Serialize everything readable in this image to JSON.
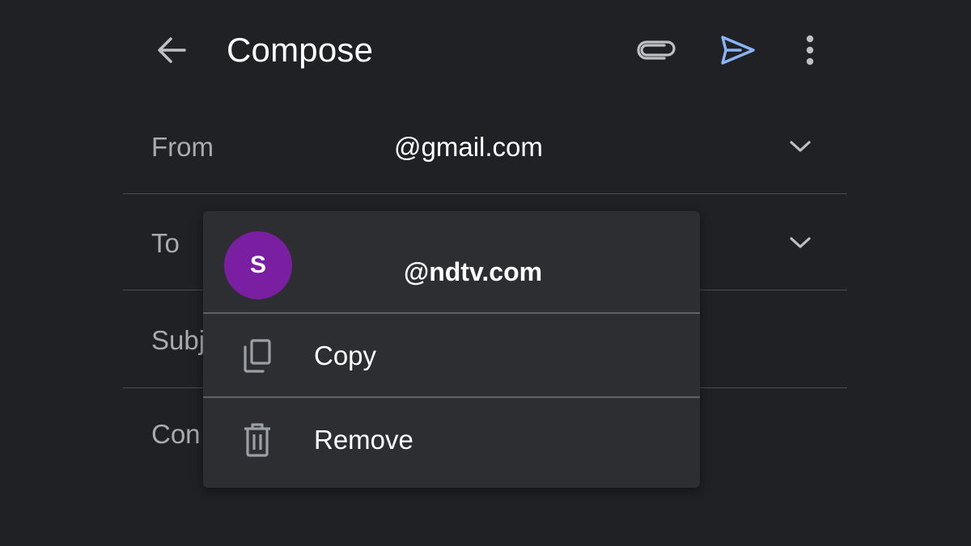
{
  "app_bar": {
    "title": "Compose",
    "back_icon": "arrow-back-icon",
    "attach_icon": "paperclip-icon",
    "send_icon": "send-icon",
    "more_icon": "more-vert-icon",
    "send_color": "#8ab4f8"
  },
  "fields": {
    "from_label": "From",
    "from_value": "@gmail.com",
    "to_label": "To",
    "subject_label": "Subj",
    "compose_label": "Con"
  },
  "recipient_menu": {
    "avatar_letter": "S",
    "avatar_color": "#7b1fa2",
    "email": "@ndtv.com",
    "items": [
      {
        "label": "Copy",
        "icon": "copy-icon"
      },
      {
        "label": "Remove",
        "icon": "trash-icon"
      }
    ]
  }
}
